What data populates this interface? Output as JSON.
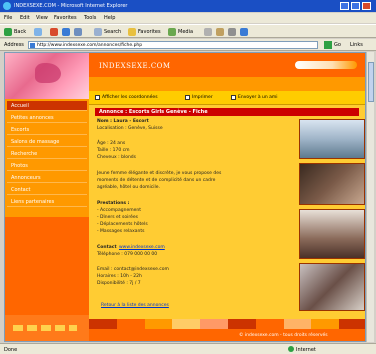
{
  "window": {
    "title": "INDEXSEXE.COM - Microsoft Internet Explorer"
  },
  "menu": [
    "File",
    "Edit",
    "View",
    "Favorites",
    "Tools",
    "Help"
  ],
  "toolbar": {
    "back_label": "Back",
    "search_label": "Search",
    "favorites_label": "Favorites",
    "media_label": "Media"
  },
  "address": {
    "label": "Address",
    "url": "http://www.indexsexe.com/annonces/fiche.php",
    "go_label": "Go",
    "links_label": "Links"
  },
  "site": {
    "brand": "INDEXSEXE.COM",
    "tagline": "",
    "nav": [
      {
        "label": "Accueil",
        "active": true
      },
      {
        "label": "Petites annonces"
      },
      {
        "label": "Escorts"
      },
      {
        "label": "Salons de massage"
      },
      {
        "label": "Recherche"
      },
      {
        "label": "Photos"
      },
      {
        "label": "Annonceurs"
      },
      {
        "label": "Contact"
      },
      {
        "label": "Liens partenaires"
      }
    ],
    "link_row": {
      "option1": "Afficher les coordonnées",
      "option2": "Imprimer",
      "option3": "Envoyer à un ami"
    },
    "section_title": "Annonce : Escorts Girls Genève - Fiche",
    "details": {
      "name_line": "Nom : Laura - Escort",
      "location_line": "Localisation : Genève, Suisse",
      "age_label": "Âge : 24 ans",
      "height_label": "Taille : 170 cm",
      "hair_label": "Cheveux : blonds",
      "desc1": "Jeune femme élégante et discrète, je vous propose des",
      "desc2": "moments de détente et de complicité dans un cadre",
      "desc3": "agréable, hôtel ou domicile.",
      "services_title": "Prestations :",
      "service1": "- Accompagnement",
      "service2": "- Dîners et soirées",
      "service3": "- Déplacements hôtels",
      "service4": "- Massages relaxants",
      "contact_title": "Contact",
      "contact_link": "www.indexsexe.com",
      "phone_line": "Téléphone : 079 000 00 00",
      "email_line": "Email : contact@indexsexe.com",
      "hours_line": "Horaires : 10h - 22h",
      "availability": "Disponibilité : 7j / 7",
      "bottom_link": "Retour à la liste des annonces"
    },
    "footer": "© indexsexe.com - tous droits réservés"
  },
  "status": {
    "left": "Done",
    "zone": "Internet"
  },
  "colors": {
    "page_bg": "#ffcc33",
    "header": "#ff6600",
    "nav": "#ff9900",
    "accent": "#cc0000"
  }
}
